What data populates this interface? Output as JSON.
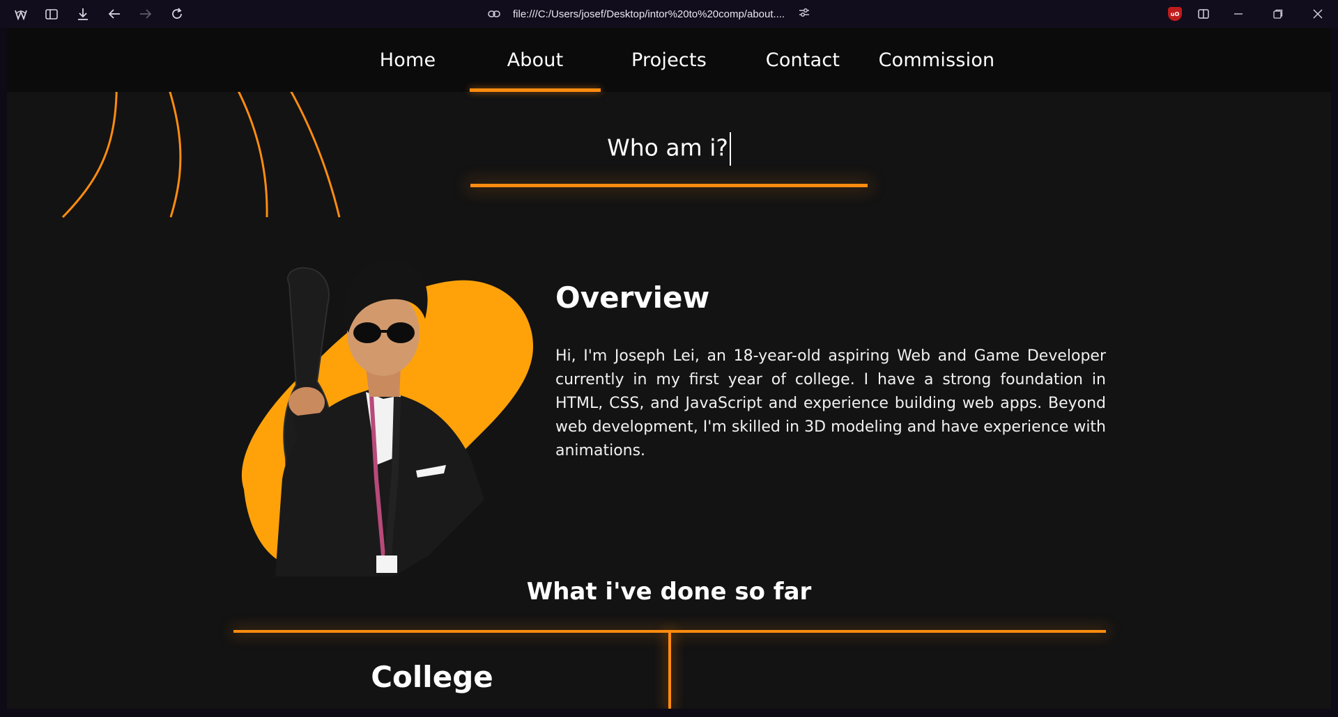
{
  "browser": {
    "url": "file:///C:/Users/josef/Desktop/intor%20to%20comp/about....",
    "icons": [
      "browser-logo-icon",
      "sidebar-icon",
      "download-icon",
      "back-icon",
      "forward-icon",
      "reload-icon",
      "link-icon",
      "tune-icon",
      "ublock-icon",
      "split-view-icon",
      "minimize-icon",
      "restore-icon",
      "close-icon"
    ],
    "ublock_label": "uO"
  },
  "nav": {
    "items": [
      {
        "label": "Home"
      },
      {
        "label": "About",
        "active": true
      },
      {
        "label": "Projects"
      },
      {
        "label": "Contact"
      },
      {
        "label": "Commission"
      }
    ]
  },
  "hero": {
    "title": "Who am i?"
  },
  "overview": {
    "title": "Overview",
    "text": "Hi, I'm Joseph Lei, an 18-year-old aspiring Web and Game Developer currently in my first year of college. I have a strong foundation in HTML, CSS, and JavaScript and experience building web apps. Beyond web development, I'm skilled in 3D modeling and have experience with animations."
  },
  "timeline": {
    "title": "What i've done so far",
    "first_item": "College"
  },
  "colors": {
    "accent": "#ff8c10",
    "blob": "#ffa20a",
    "background": "#131313",
    "navbar": "#0b0b0b"
  }
}
